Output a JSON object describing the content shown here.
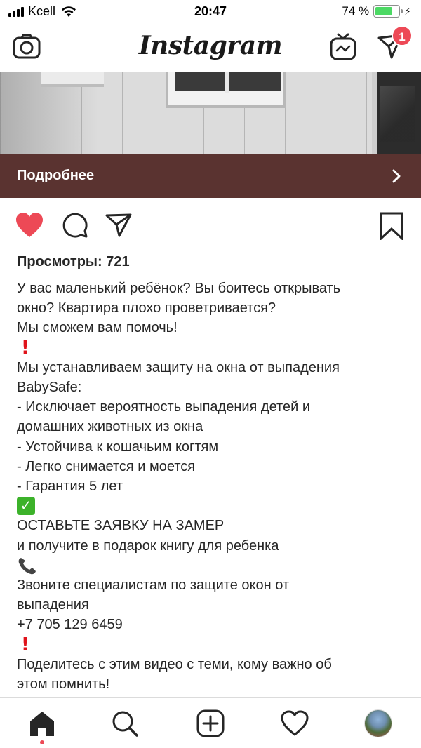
{
  "status_bar": {
    "carrier": "Kcell",
    "time": "20:47",
    "battery_percent": "74 %",
    "battery_level": 0.74,
    "battery_color": "#4cd964"
  },
  "header": {
    "logo_text": "Instagram",
    "left_icon": "camera-icon",
    "right_icons": [
      "igtv-icon",
      "direct-message-icon"
    ],
    "direct_badge_count": "1",
    "badge_color": "#ed4956"
  },
  "post": {
    "cta_label": "Подробнее",
    "cta_color": "#5a3330",
    "action_icons": [
      "heart-icon",
      "comment-icon",
      "share-icon",
      "bookmark-icon"
    ],
    "liked": true,
    "like_color": "#ed4956",
    "views": "Просмотры: 721",
    "caption_lines": [
      "У вас маленький ребёнок? Вы боитесь открывать",
      "окно? Квартира плохо проветривается?",
      "Мы сможем вам помочь!",
      "!",
      "Мы устанавливаем защиту на окна от выпадения",
      "BabySafe:",
      "- Исключает вероятность выпадения детей и",
      "домашних животных из окна",
      "- Устойчива к кошачьим когтям",
      "- Легко снимается и моется",
      "- Гарантия 5 лет",
      "✓",
      "ОСТАВЬТЕ ЗАЯВКУ НА ЗАМЕР",
      "и получите в подарок книгу для ребенка",
      "phone",
      "Звоните специалистам по защите окон от",
      "выпадения",
      "+7 705 129 6459",
      "!",
      "Поделитесь с этим видео с теми, кому важно об",
      "этом помнить!"
    ]
  },
  "tab_bar": {
    "tabs": [
      "home-icon",
      "search-icon",
      "new-post-icon",
      "activity-icon",
      "profile-avatar"
    ],
    "active": "home-icon"
  }
}
